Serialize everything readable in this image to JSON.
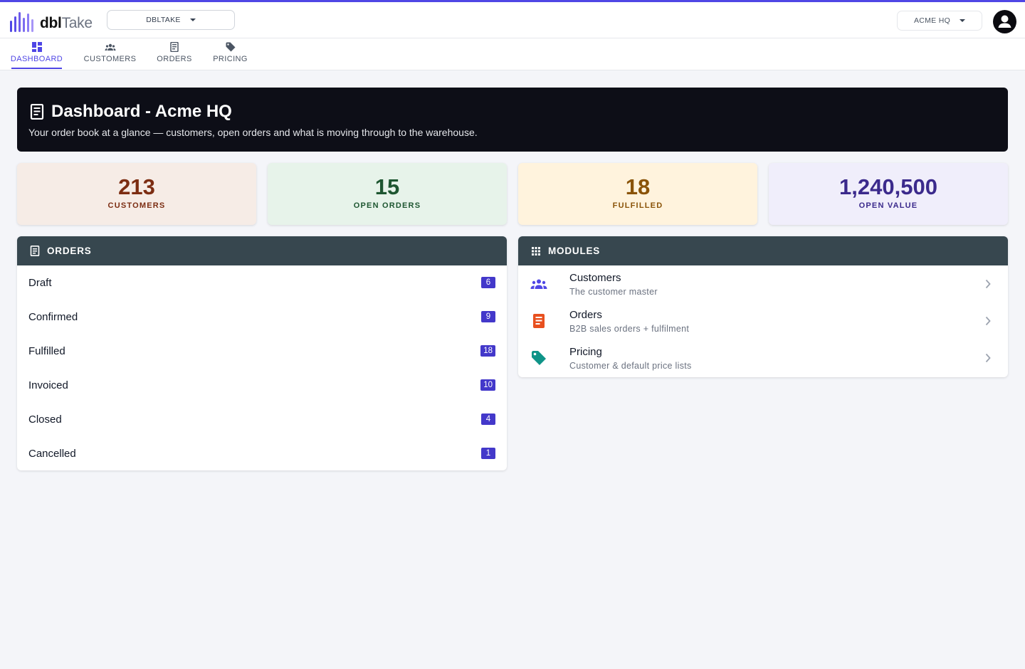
{
  "colors": {
    "accent": "#4f46e5",
    "hero_bg": "#0d0e17",
    "panel_head": "#37474f",
    "badge": "#4338ca"
  },
  "brand": {
    "name_bold": "dbl",
    "name_light": "Take"
  },
  "topbar": {
    "tenant_select": "DBLTAKE",
    "company_select": "ACME HQ",
    "avatar_icon": "account-circle-icon"
  },
  "tabs": [
    {
      "label": "DASHBOARD",
      "icon": "dashboard-icon",
      "active": true
    },
    {
      "label": "CUSTOMERS",
      "icon": "people-icon",
      "active": false
    },
    {
      "label": "ORDERS",
      "icon": "receipt-icon",
      "active": false
    },
    {
      "label": "PRICING",
      "icon": "tag-icon",
      "active": false
    }
  ],
  "hero": {
    "title": "Dashboard - Acme HQ",
    "subtitle": "Your order book at a glance — customers, open orders and what is moving through to the warehouse."
  },
  "kpis": [
    {
      "value": "213",
      "label": "CUSTOMERS",
      "bg": "#f6ece6",
      "color": "#7c2d12"
    },
    {
      "value": "15",
      "label": "OPEN ORDERS",
      "bg": "#e7f3ea",
      "color": "#1e5631"
    },
    {
      "value": "18",
      "label": "FULFILLED",
      "bg": "#fff3dd",
      "color": "#8a5308"
    },
    {
      "value": "1,240,500",
      "label": "OPEN VALUE",
      "bg": "#f0eefb",
      "color": "#3b2a8c"
    }
  ],
  "orders_panel": {
    "title": "ORDERS",
    "rows": [
      {
        "label": "Draft",
        "count": "6"
      },
      {
        "label": "Confirmed",
        "count": "9"
      },
      {
        "label": "Fulfilled",
        "count": "18"
      },
      {
        "label": "Invoiced",
        "count": "10"
      },
      {
        "label": "Closed",
        "count": "4"
      },
      {
        "label": "Cancelled",
        "count": "1"
      }
    ]
  },
  "modules_panel": {
    "title": "MODULES",
    "rows": [
      {
        "title": "Customers",
        "desc": "The customer master",
        "icon": "people-icon",
        "color": "#4f46e5"
      },
      {
        "title": "Orders",
        "desc": "B2B sales orders + fulfilment",
        "icon": "receipt-icon",
        "color": "#e8501f"
      },
      {
        "title": "Pricing",
        "desc": "Customer & default price lists",
        "icon": "tag-icon",
        "color": "#0f9488"
      }
    ]
  }
}
